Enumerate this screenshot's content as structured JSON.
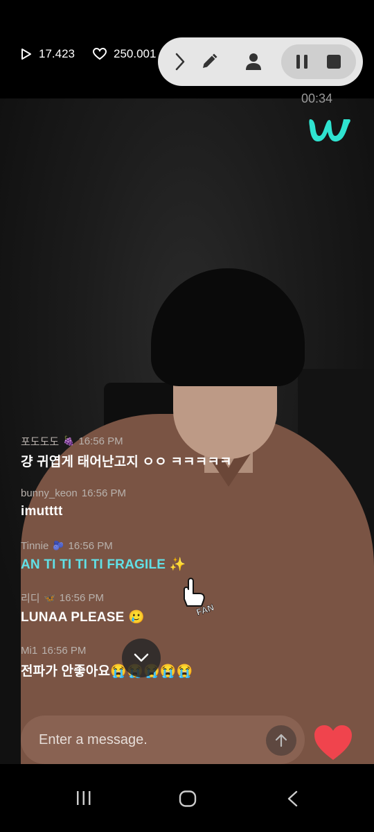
{
  "stats": {
    "plays": "17.423",
    "likes": "250.001"
  },
  "recorder": {
    "icons": [
      "chevron-right-icon",
      "pen-icon",
      "person-icon",
      "pause-icon",
      "stop-icon"
    ]
  },
  "video": {
    "timer": "00:34",
    "logo": "weverse-logo"
  },
  "chat": {
    "messages": [
      {
        "user": "포도도도",
        "user_emoji": "🍇",
        "time": "16:56 PM",
        "text": "걍 귀엽게 태어난고지 ㅇㅇ ㅋㅋㅋㅋㅋ",
        "highlight": false
      },
      {
        "user": "bunny_keon",
        "user_emoji": "",
        "time": "16:56 PM",
        "text": "imutttt",
        "highlight": false
      },
      {
        "user": "Tinnie",
        "user_emoji": "🫐",
        "time": "16:56 PM",
        "text": "AN TI TI TI TI FRAGILE ✨",
        "highlight": true
      },
      {
        "user": "리디",
        "user_emoji": "🦋",
        "time": "16:56 PM",
        "text": "LUNAA PLEASE 🥲",
        "highlight": false
      },
      {
        "user": "Mi1",
        "user_emoji": "",
        "time": "16:56 PM",
        "text": "전파가 안좋아요😭😭😭😭😭",
        "highlight": false
      }
    ],
    "fan_badge": "FAN"
  },
  "input": {
    "placeholder": "Enter a message."
  },
  "colors": {
    "accent": "#61e0e6",
    "heart": "#f0444d",
    "logo": "#2fe3d0"
  }
}
